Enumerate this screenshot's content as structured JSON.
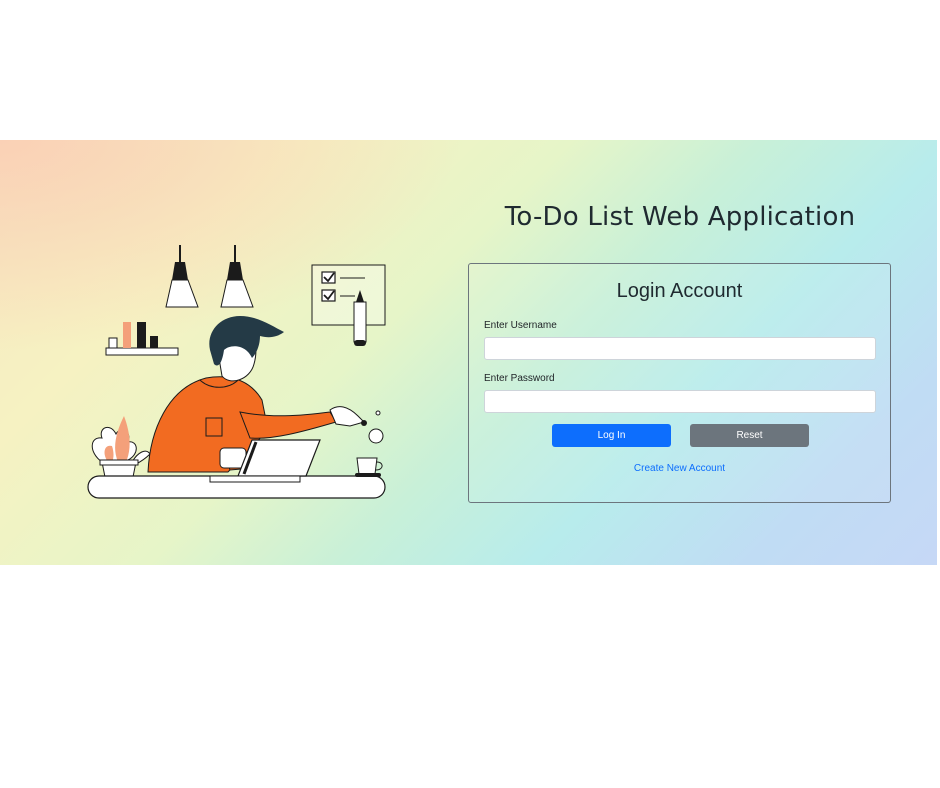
{
  "app": {
    "title": "To-Do List Web Application"
  },
  "login_form": {
    "heading": "Login Account",
    "username_label": "Enter Username",
    "username_value": "",
    "password_label": "Enter Password",
    "password_value": "",
    "login_button": "Log In",
    "reset_button": "Reset",
    "create_account_link": "Create New Account"
  },
  "illustration": {
    "subject": "person-working-at-laptop-illustration",
    "accent_color": "#f26b21",
    "line_color": "#1b1b1b"
  },
  "colors": {
    "primary": "#0d6efd",
    "secondary": "#6c757d",
    "text": "#1f2a30"
  }
}
